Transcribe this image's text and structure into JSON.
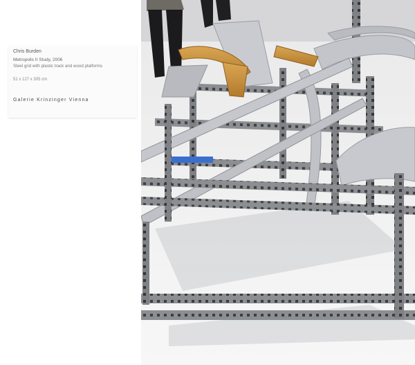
{
  "label": {
    "artist": "Chris Burden",
    "work": "Metropolis II Study, 2006",
    "medium": "Steel grid with plastic track and wood platforms",
    "dimensions": "51 x 127 x 305 cm",
    "gallery": "Galerie Krinzinger Vienna"
  },
  "colors": {
    "steel": "#8c8e92",
    "steel_dark": "#5c5e63",
    "track": "#c9cbd0",
    "wood": "#c9923f",
    "floor": "#f4f4f4",
    "blue_part": "#3a6fd0"
  }
}
